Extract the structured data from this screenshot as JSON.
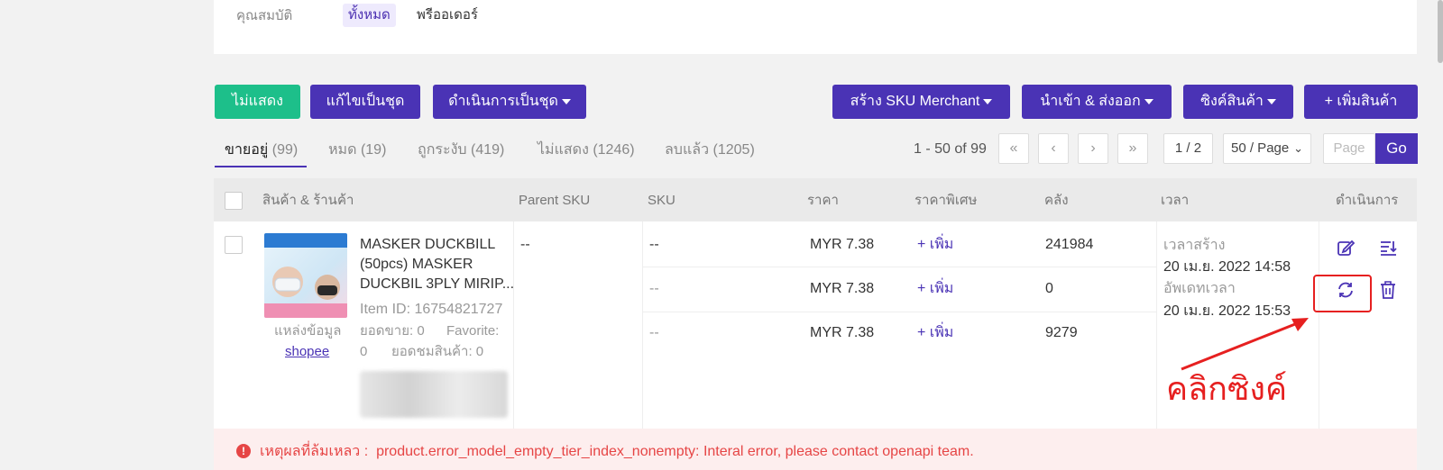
{
  "filter": {
    "label": "คุณสมบัติ",
    "chips": [
      "ทั้งหมด",
      "พรีออเดอร์"
    ]
  },
  "toolbar": {
    "hide_label": "ไม่แสดง",
    "bulk_edit_label": "แก้ไขเป็นชุด",
    "bulk_action_label": "ดำเนินการเป็นชุด",
    "create_sku_label": "สร้าง SKU Merchant",
    "import_export_label": "นำเข้า & ส่งออก",
    "sync_label": "ซิงค์สินค้า",
    "add_product_label": "+ เพิ่มสินค้า"
  },
  "tabs": [
    {
      "label": "ขายอยู่",
      "count": "(99)"
    },
    {
      "label": "หมด",
      "count": "(19)"
    },
    {
      "label": "ถูกระงับ",
      "count": "(419)"
    },
    {
      "label": "ไม่แสดง",
      "count": "(1246)"
    },
    {
      "label": "ลบแล้ว",
      "count": "(1205)"
    }
  ],
  "pagination": {
    "range": "1 - 50 of 99",
    "page": "1 / 2",
    "per_page": "50 / Page",
    "page_placeholder": "Page",
    "go_label": "Go"
  },
  "table": {
    "headers": {
      "product": "สินค้า & ร้านค้า",
      "parent_sku": "Parent SKU",
      "sku": "SKU",
      "price": "ราคา",
      "special_price": "ราคาพิเศษ",
      "stock": "คลัง",
      "time": "เวลา",
      "actions": "ดำเนินการ"
    },
    "row": {
      "title_line1": "MASKER DUCKBILL",
      "title_line2": "(50pcs) MASKER",
      "title_line3": "DUCKBIL 3PLY MIRIP...",
      "item_id": "Item ID: 16754821727",
      "sales_label": "ยอดขาย: 0",
      "favorite_label": "Favorite:",
      "favorite_value": "0",
      "views_label": "ยอดชมสินค้า: 0",
      "source_label": "แหล่งข้อมูล",
      "source_link": "shopee",
      "parent_sku": "--",
      "created_label": "เวลาสร้าง",
      "created_value": "20 เม.ย. 2022 14:58",
      "updated_label": "อัพเดทเวลา",
      "updated_value": "20 เม.ย. 2022 15:53",
      "variants": [
        {
          "sku": "--",
          "price": "MYR 7.38",
          "special": "+ เพิ่ม",
          "stock": "241984"
        },
        {
          "sku": "--",
          "price": "MYR 7.38",
          "special": "+ เพิ่ม",
          "stock": "0"
        },
        {
          "sku": "--",
          "price": "MYR 7.38",
          "special": "+ เพิ่ม",
          "stock": "9279"
        }
      ]
    }
  },
  "annotation": "คลิกซิงค์",
  "error": {
    "label": "เหตุผลที่ล้มเหลว :",
    "message": "product.error_model_empty_tier_index_nonempty: Interal error, please contact openapi team."
  },
  "colors": {
    "brand": "#4a33b5",
    "green": "#1dbf8a",
    "error": "#e64545",
    "annotation": "#e62020"
  }
}
